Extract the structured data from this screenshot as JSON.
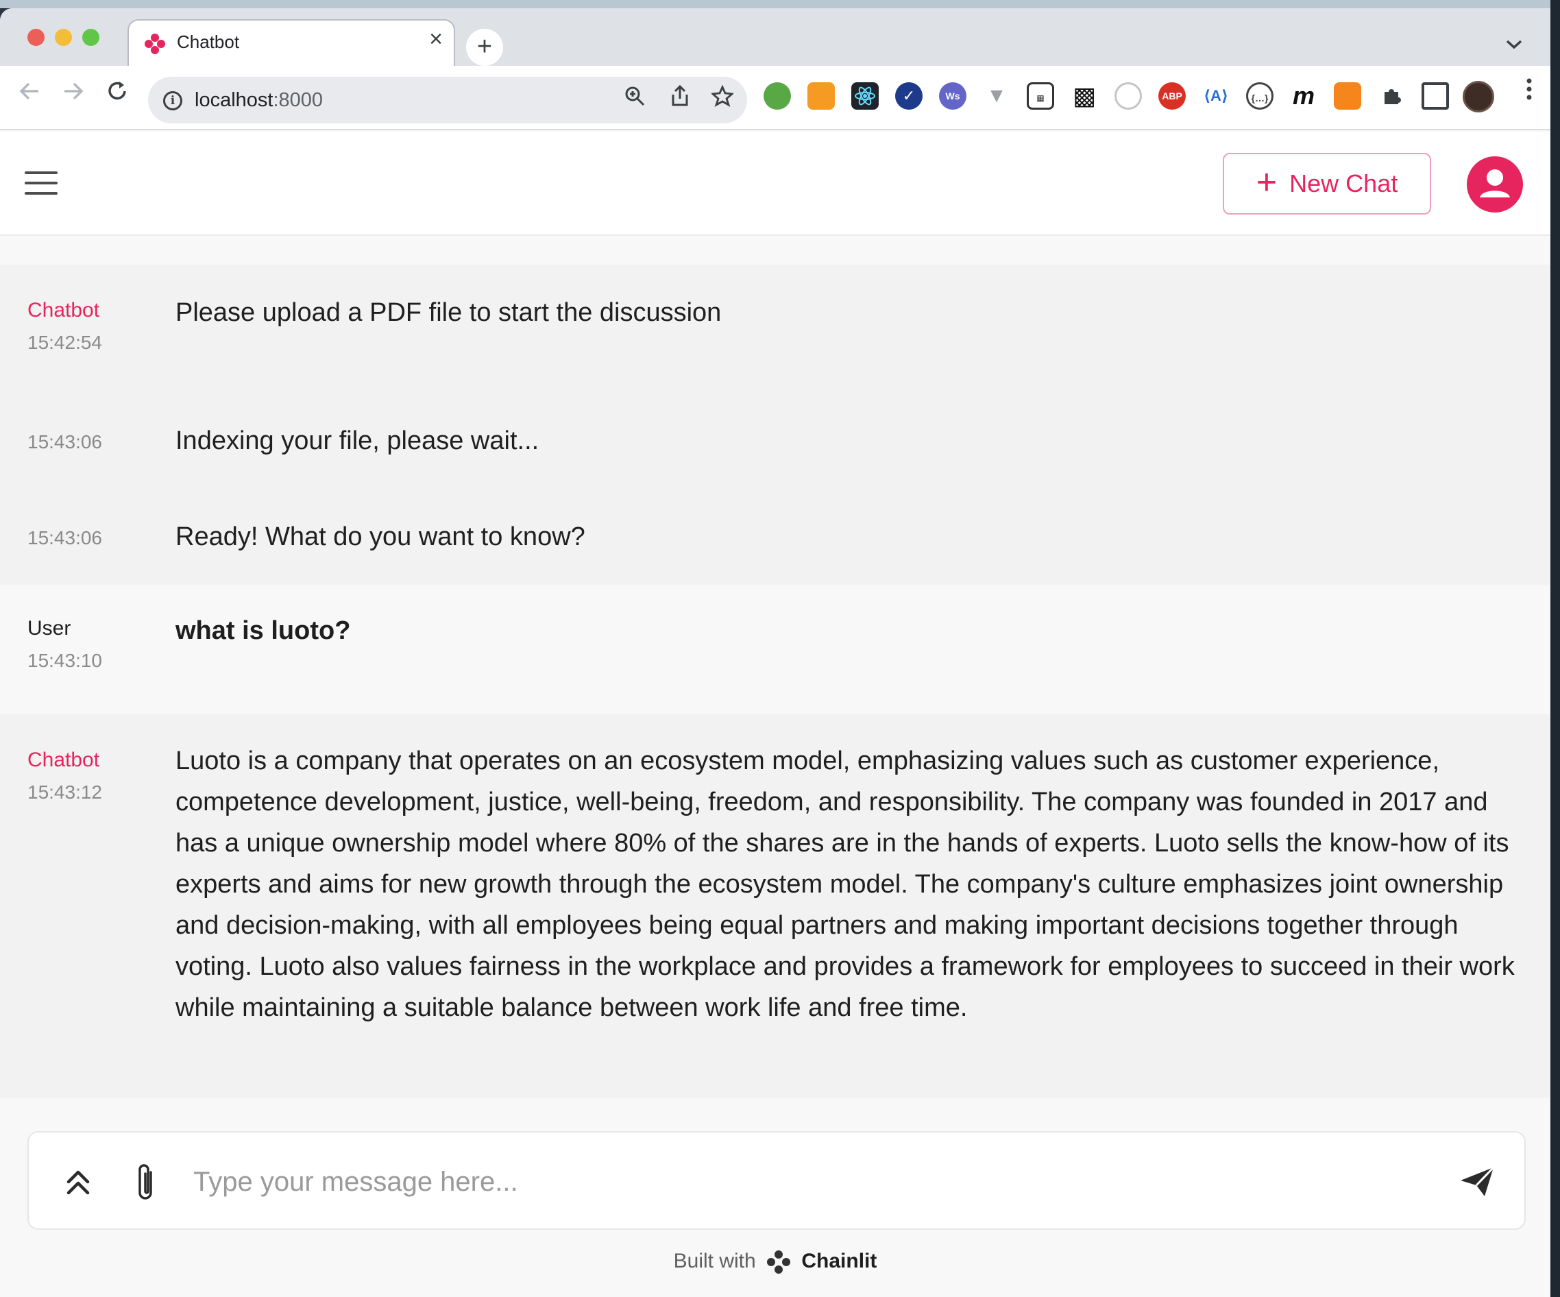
{
  "browser": {
    "tab_title": "Chatbot",
    "tab_close": "×",
    "new_tab": "+",
    "tab_list": "⌄",
    "url_host": "localhost",
    "url_port": ":8000",
    "info": "i",
    "extensions": [
      "evernote-icon",
      "stack-icon",
      "react-devtools-icon",
      "check-icon",
      "ws-icon",
      "vue-icon",
      "qr-icon",
      "qr-code-icon",
      "circle-icon",
      "adblock-icon",
      "a-icon",
      "json-icon",
      "m-icon",
      "metamask-icon",
      "puzzle-icon",
      "sidepanel-icon"
    ],
    "abp_label": "ABP",
    "a_label": "⟨A⟩",
    "m_label": "m"
  },
  "header": {
    "new_chat_label": "New Chat",
    "new_chat_plus": "+"
  },
  "messages": [
    {
      "author": "Chatbot",
      "time": "15:42:54",
      "text": "Please upload a PDF file to start the discussion"
    },
    {
      "author": "",
      "time": "15:43:06",
      "text": "Indexing your file, please wait..."
    },
    {
      "author": "",
      "time": "15:43:06",
      "text": "Ready! What do you want to know?"
    },
    {
      "author": "User",
      "time": "15:43:10",
      "text": "what is luoto?"
    },
    {
      "author": "Chatbot",
      "time": "15:43:12",
      "text": "Luoto is a company that operates on an ecosystem model, emphasizing values such as customer experience, competence development, justice, well-being, freedom, and responsibility. The company was founded in 2017 and has a unique ownership model where 80% of the shares are in the hands of experts. Luoto sells the know-how of its experts and aims for new growth through the ecosystem model. The company's culture emphasizes joint ownership and decision-making, with all employees being equal partners and making important decisions together through voting. Luoto also values fairness in the workplace and provides a framework for employees to succeed in their work while maintaining a suitable balance between work life and free time."
    }
  ],
  "composer": {
    "placeholder": "Type your message here..."
  },
  "footer": {
    "built_with": "Built with",
    "brand": "Chainlit"
  },
  "colors": {
    "accent": "#e6255f"
  }
}
